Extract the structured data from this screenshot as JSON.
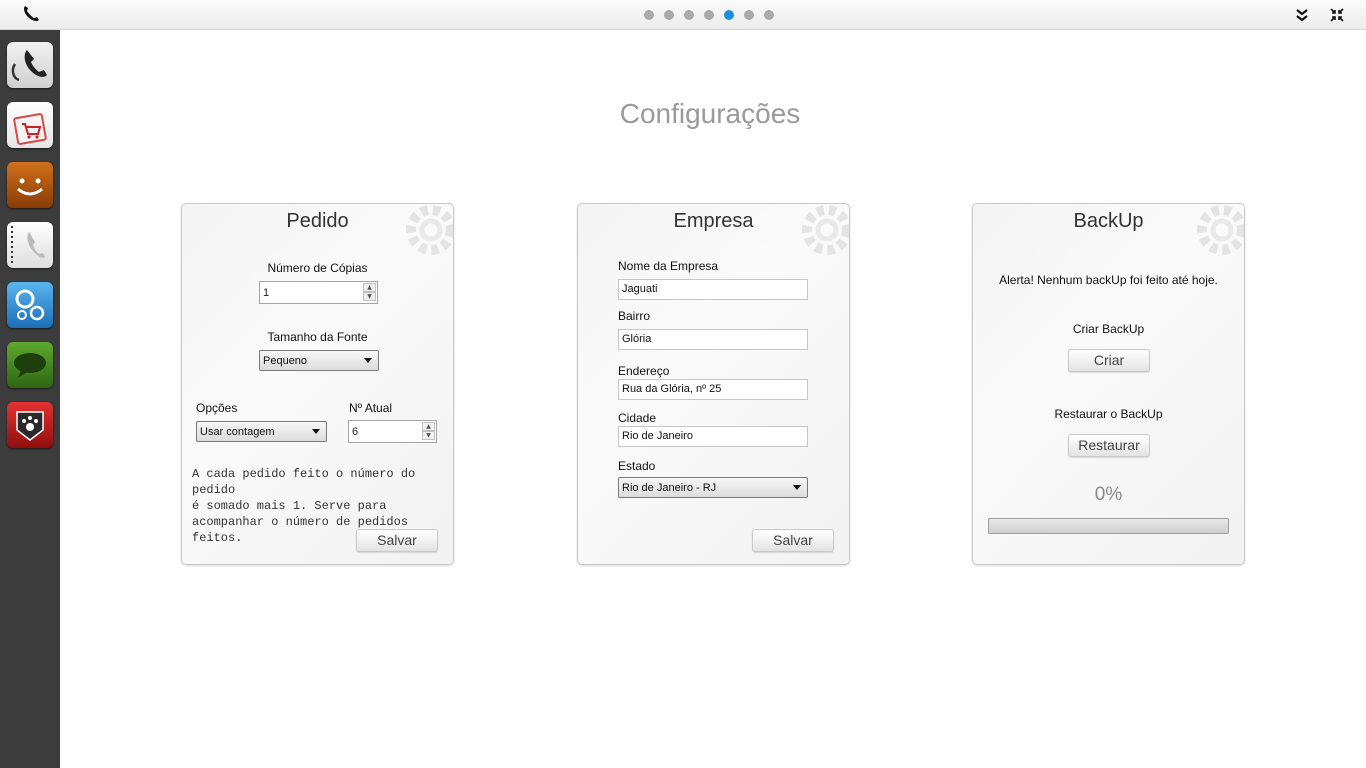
{
  "topbar": {
    "pages_total": 7,
    "active_page_index": 4
  },
  "sidebar": {
    "apps": [
      {
        "name": "phone-manager-app",
        "icon": "phone-handset-icon"
      },
      {
        "name": "shopping-bag-app",
        "icon": "shopping-cart-icon"
      },
      {
        "name": "smiley-app",
        "icon": "smiley-face-icon"
      },
      {
        "name": "notebook-app",
        "icon": "notebook-phone-icon"
      },
      {
        "name": "settings-app",
        "icon": "gears-icon"
      },
      {
        "name": "messages-app",
        "icon": "speech-bubble-icon"
      },
      {
        "name": "jaguar-app",
        "icon": "paw-badge-icon"
      }
    ]
  },
  "page_title": "Configurações",
  "pedido": {
    "title": "Pedido",
    "copies_label": "Número de Cópias",
    "copies_value": "1",
    "font_size_label": "Tamanho da  Fonte",
    "font_size_value": "Pequeno",
    "options_label": "Opções",
    "options_value": "Usar contagem",
    "current_label": "Nº Atual",
    "current_value": "6",
    "description_line1": "A cada pedido feito o número do pedido",
    "description_line2": "é somado mais 1. Serve para",
    "description_line3": "acompanhar o número de pedidos",
    "description_line4": "feitos.",
    "save_label": "Salvar"
  },
  "empresa": {
    "title": "Empresa",
    "name_label": "Nome da Empresa",
    "name_value": "Jaguati",
    "district_label": "Bairro",
    "district_value": "Glória",
    "address_label": "Endereço",
    "address_value": "Rua da Glória, nº 25",
    "city_label": "Cidade",
    "city_value": "Rio de Janeiro",
    "state_label": "Estado",
    "state_value": "Rio de Janeiro - RJ",
    "save_label": "Salvar"
  },
  "backup": {
    "title": "BackUp",
    "alert_text": "Alerta!  Nenhum backUp foi feito até hoje.",
    "create_label": "Criar  BackUp",
    "create_button": "Criar",
    "restore_label": "Restaurar o  BackUp",
    "restore_button": "Restaurar",
    "progress_text": "0%",
    "progress_fraction": 0
  },
  "colors": {
    "sidebar_bg": "#3c3c3c",
    "active_dot": "#1e8fde",
    "inactive_dot": "#a9a9a9"
  }
}
